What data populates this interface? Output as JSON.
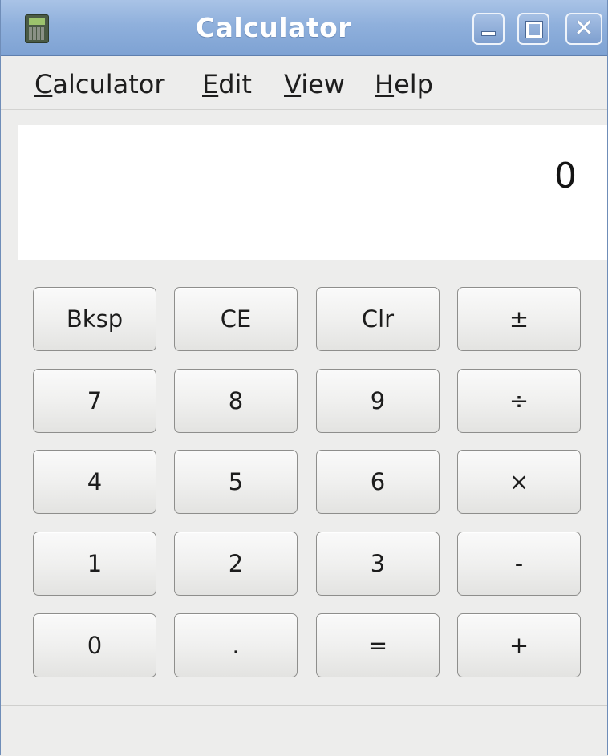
{
  "window": {
    "title": "Calculator",
    "icon": "calculator-app-icon",
    "controls": {
      "minimize": "minimize-icon",
      "maximize": "maximize-icon",
      "close": "close-icon",
      "close_glyph": "✕"
    }
  },
  "menu": [
    {
      "accel": "C",
      "rest": "alculator"
    },
    {
      "accel": "E",
      "rest": "dit"
    },
    {
      "accel": "V",
      "rest": "iew"
    },
    {
      "accel": "H",
      "rest": "elp"
    }
  ],
  "display": {
    "value": "0"
  },
  "keys": [
    [
      "Bksp",
      "CE",
      "Clr",
      "±"
    ],
    [
      "7",
      "8",
      "9",
      "÷"
    ],
    [
      "4",
      "5",
      "6",
      "×"
    ],
    [
      "1",
      "2",
      "3",
      "-"
    ],
    [
      "0",
      ".",
      "=",
      "+"
    ]
  ],
  "colors": {
    "titlebar": "#8fb0dc",
    "window_bg": "#ededec",
    "display_bg": "#ffffff"
  }
}
